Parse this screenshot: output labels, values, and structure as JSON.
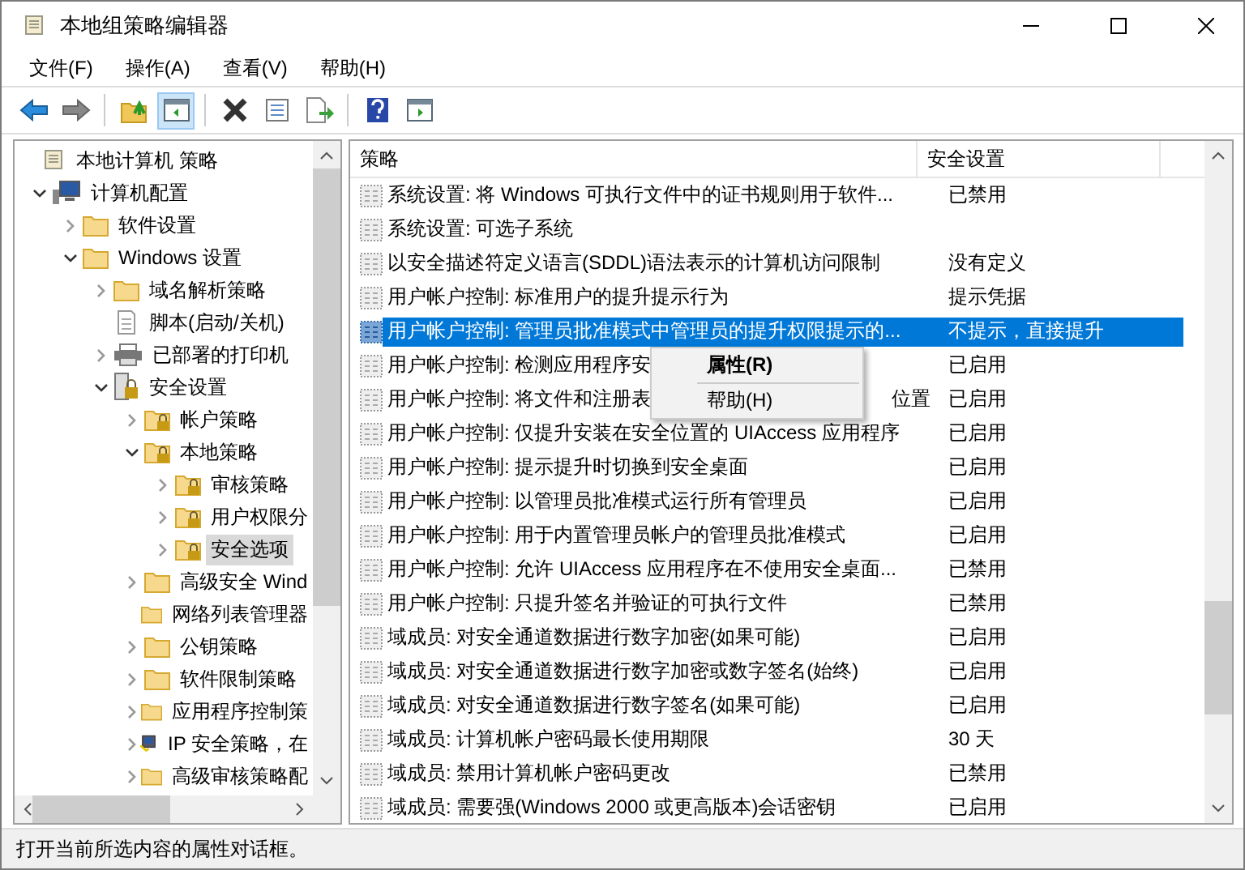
{
  "window": {
    "title": "本地组策略编辑器"
  },
  "menu": [
    "文件(F)",
    "操作(A)",
    "查看(V)",
    "帮助(H)"
  ],
  "toolbar": [
    {
      "kind": "back"
    },
    {
      "kind": "forward"
    },
    {
      "kind": "sep"
    },
    {
      "kind": "up",
      "pressed": false
    },
    {
      "kind": "tree",
      "pressed": true
    },
    {
      "kind": "sep"
    },
    {
      "kind": "delete"
    },
    {
      "kind": "properties"
    },
    {
      "kind": "export"
    },
    {
      "kind": "sep"
    },
    {
      "kind": "help"
    },
    {
      "kind": "view"
    }
  ],
  "tree": [
    {
      "label": "本地计算机 策略",
      "kind": "policy",
      "selected": false,
      "children": [
        {
          "label": "计算机配置",
          "kind": "computer",
          "expanded": true,
          "selected": false,
          "children": [
            {
              "label": "软件设置",
              "kind": "folder",
              "expanded": false,
              "selected": false
            },
            {
              "label": "Windows 设置",
              "kind": "folder",
              "expanded": true,
              "selected": false,
              "children": [
                {
                  "label": "域名解析策略",
                  "kind": "folder",
                  "expanded": false,
                  "selected": false
                },
                {
                  "label": "脚本(启动/关机)",
                  "kind": "script",
                  "selected": false
                },
                {
                  "label": "已部署的打印机",
                  "kind": "printer",
                  "expanded": false,
                  "selected": false
                },
                {
                  "label": "安全设置",
                  "kind": "security",
                  "expanded": true,
                  "selected": false,
                  "children": [
                    {
                      "label": "帐户策略",
                      "kind": "lockfolder",
                      "expanded": false,
                      "selected": false
                    },
                    {
                      "label": "本地策略",
                      "kind": "lockfolder",
                      "expanded": true,
                      "selected": false,
                      "children": [
                        {
                          "label": "审核策略",
                          "kind": "lockfolder",
                          "expanded": false,
                          "selected": false
                        },
                        {
                          "label": "用户权限分",
                          "kind": "lockfolder",
                          "expanded": false,
                          "selected": false
                        },
                        {
                          "label": "安全选项",
                          "kind": "lockfolder",
                          "expanded": false,
                          "selected": true
                        }
                      ]
                    },
                    {
                      "label": "高级安全 Wind",
                      "kind": "folder",
                      "expanded": false,
                      "selected": false
                    },
                    {
                      "label": "网络列表管理器",
                      "kind": "folder",
                      "selected": false
                    },
                    {
                      "label": "公钥策略",
                      "kind": "folder",
                      "expanded": false,
                      "selected": false
                    },
                    {
                      "label": "软件限制策略",
                      "kind": "folder",
                      "expanded": false,
                      "selected": false
                    },
                    {
                      "label": "应用程序控制策",
                      "kind": "folder",
                      "expanded": false,
                      "selected": false
                    },
                    {
                      "label": "IP 安全策略，在",
                      "kind": "ipsec",
                      "expanded": false,
                      "selected": false
                    },
                    {
                      "label": "高级审核策略配",
                      "kind": "folder",
                      "expanded": false,
                      "selected": false
                    }
                  ]
                }
              ]
            }
          ]
        }
      ]
    }
  ],
  "table": {
    "columns": [
      "策略",
      "安全设置"
    ],
    "rows": [
      {
        "policy": "系统设置: 将 Windows 可执行文件中的证书规则用于软件...",
        "setting": "已禁用",
        "selected": false
      },
      {
        "policy": "系统设置: 可选子系统",
        "setting": "",
        "selected": false
      },
      {
        "policy": "以安全描述符定义语言(SDDL)语法表示的计算机访问限制",
        "setting": "没有定义",
        "selected": false
      },
      {
        "policy": "用户帐户控制: 标准用户的提升提示行为",
        "setting": "提示凭据",
        "selected": false
      },
      {
        "policy": "用户帐户控制: 管理员批准模式中管理员的提升权限提示的...",
        "setting": "不提示，直接提升",
        "selected": true
      },
      {
        "policy": "用户帐户控制: 检测应用程序安",
        "setting": "已启用",
        "selected": false
      },
      {
        "policy": "用户帐户控制: 将文件和注册表",
        "tail": "位置",
        "setting": "已启用",
        "selected": false
      },
      {
        "policy": "用户帐户控制: 仅提升安装在安全位置的 UIAccess 应用程序",
        "setting": "已启用",
        "selected": false
      },
      {
        "policy": "用户帐户控制: 提示提升时切换到安全桌面",
        "setting": "已启用",
        "selected": false
      },
      {
        "policy": "用户帐户控制: 以管理员批准模式运行所有管理员",
        "setting": "已启用",
        "selected": false
      },
      {
        "policy": "用户帐户控制: 用于内置管理员帐户的管理员批准模式",
        "setting": "已启用",
        "selected": false
      },
      {
        "policy": "用户帐户控制: 允许 UIAccess 应用程序在不使用安全桌面...",
        "setting": "已禁用",
        "selected": false
      },
      {
        "policy": "用户帐户控制: 只提升签名并验证的可执行文件",
        "setting": "已禁用",
        "selected": false
      },
      {
        "policy": "域成员: 对安全通道数据进行数字加密(如果可能)",
        "setting": "已启用",
        "selected": false
      },
      {
        "policy": "域成员: 对安全通道数据进行数字加密或数字签名(始终)",
        "setting": "已启用",
        "selected": false
      },
      {
        "policy": "域成员: 对安全通道数据进行数字签名(如果可能)",
        "setting": "已启用",
        "selected": false
      },
      {
        "policy": "域成员: 计算机帐户密码最长使用期限",
        "setting": "30 天",
        "selected": false
      },
      {
        "policy": "域成员: 禁用计算机帐户密码更改",
        "setting": "已禁用",
        "selected": false
      },
      {
        "policy": "域成员: 需要强(Windows 2000 或更高版本)会话密钥",
        "setting": "已启用",
        "selected": false
      }
    ]
  },
  "context_menu": [
    "属性(R)",
    "帮助(H)"
  ],
  "status_bar": "打开当前所选内容的属性对话框。"
}
